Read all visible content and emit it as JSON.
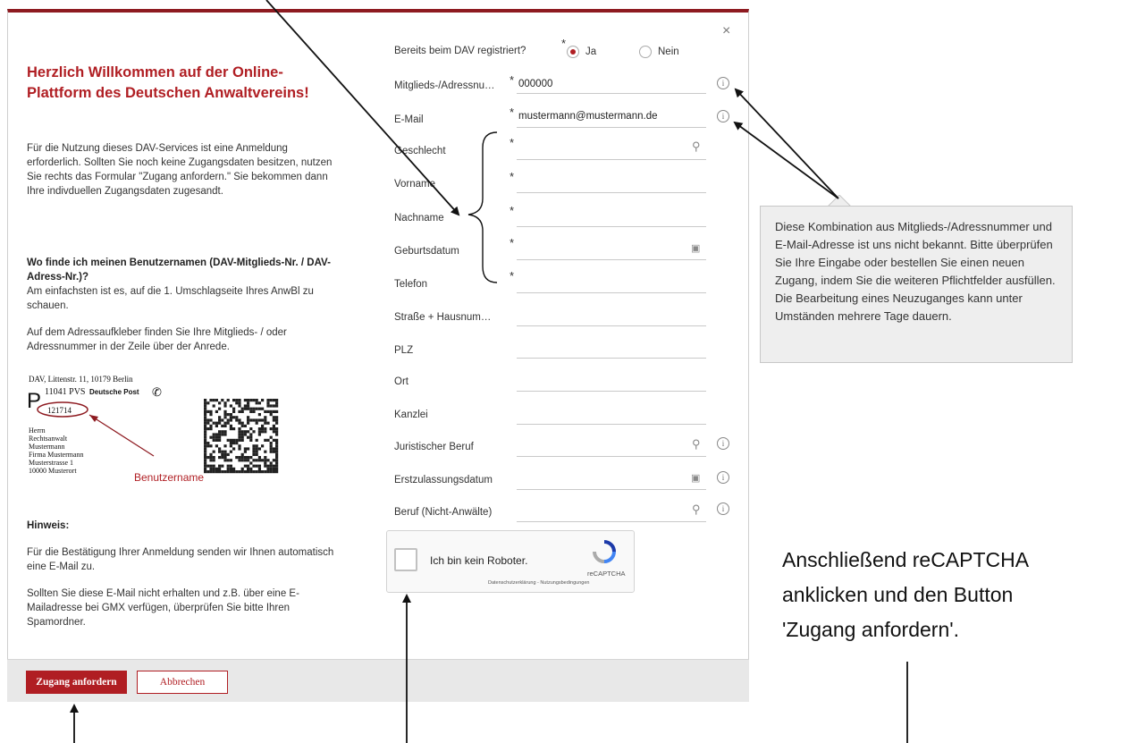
{
  "modal": {
    "close_label": "×",
    "welcome_title": "Herzlich Willkommen auf der Online-Plattform des Deutschen Anwaltvereins!",
    "intro_text": "Für die Nutzung dieses DAV-Services ist eine Anmeldung erforderlich. Sollten Sie noch keine Zugangsdaten besitzen, nutzen Sie rechts das Formular \"Zugang anfordern.\" Sie bekommen dann Ihre indivduellen Zugangsdaten zugesandt.",
    "username_heading": "Wo finde ich meinen Benutzernamen (DAV-Mitglieds-Nr. / DAV-Adress-Nr.)?",
    "username_text1": "Am einfachsten ist es, auf die 1. Umschlagseite Ihres AnwBl zu schauen.",
    "username_text2": "Auf dem Adressaufkleber finden Sie Ihre Mitglieds- / oder Adressnummer in der Zeile über der Anrede.",
    "hint_heading": "Hinweis:",
    "hint_text1": "Für die Bestätigung Ihrer Anmeldung senden wir Ihnen automatisch eine E-Mail zu.",
    "hint_text2": "Sollten Sie diese E-Mail nicht erhalten und z.B. über eine E-Mailadresse bei GMX verfügen, überprüfen Sie bitte Ihren Spamordner."
  },
  "label_image": {
    "sender": "DAV, Littenstr. 11, 10179 Berlin",
    "p_letter": "P",
    "pvs_line": "11041 PVS",
    "deutsche_post": "Deutsche Post",
    "number": "121714",
    "addr1": "Herrn",
    "addr2": "Rechtsanwalt",
    "addr3": "Mustermann",
    "addr4": "Firma Mustermann",
    "addr5": "Musterstrasse 1",
    "addr6": "10000 Musterort",
    "benutzername": "Benutzername"
  },
  "form": {
    "registered_label": "Bereits beim DAV registriert?",
    "radio_yes": "Ja",
    "radio_no": "Nein",
    "member_label": "Mitglieds-/Adressnu…",
    "member_value": "000000",
    "email_label": "E-Mail",
    "email_value": "mustermann@mustermann.de",
    "gender_label": "Geschlecht",
    "firstname_label": "Vorname",
    "lastname_label": "Nachname",
    "birthdate_label": "Geburtsdatum",
    "phone_label": "Telefon",
    "street_label": "Straße + Hausnum…",
    "zip_label": "PLZ",
    "city_label": "Ort",
    "firm_label": "Kanzlei",
    "profession_label": "Juristischer Beruf",
    "admission_label": "Erstzulassungsdatum",
    "nonlawyer_label": "Beruf (Nicht-Anwälte)"
  },
  "captcha": {
    "label": "Ich bin kein Roboter.",
    "brand": "reCAPTCHA",
    "links": "Datenschutzerklärung - Nutzungsbedingungen"
  },
  "footer": {
    "submit_label": "Zugang anfordern",
    "cancel_label": "Abbrechen"
  },
  "tooltip": {
    "text": "Diese Kombination aus Mitglieds-/Adressnummer und E-Mail-Adresse ist uns nicht bekannt. Bitte überprüfen Sie Ihre Eingabe oder bestellen Sie einen neuen Zugang, indem Sie die weiteren Pflichtfelder ausfüllen. Die Bearbeitung eines Neuzuganges kann unter Umständen mehrere Tage dauern."
  },
  "annotation": {
    "line1": "Anschließend reCAPTCHA",
    "line2": "anklicken und den Button",
    "line3": "'Zugang anfordern'."
  },
  "colors": {
    "brand": "#b01e23",
    "header_bar": "#8e1b21",
    "footer_bg": "#e8e8e8"
  }
}
